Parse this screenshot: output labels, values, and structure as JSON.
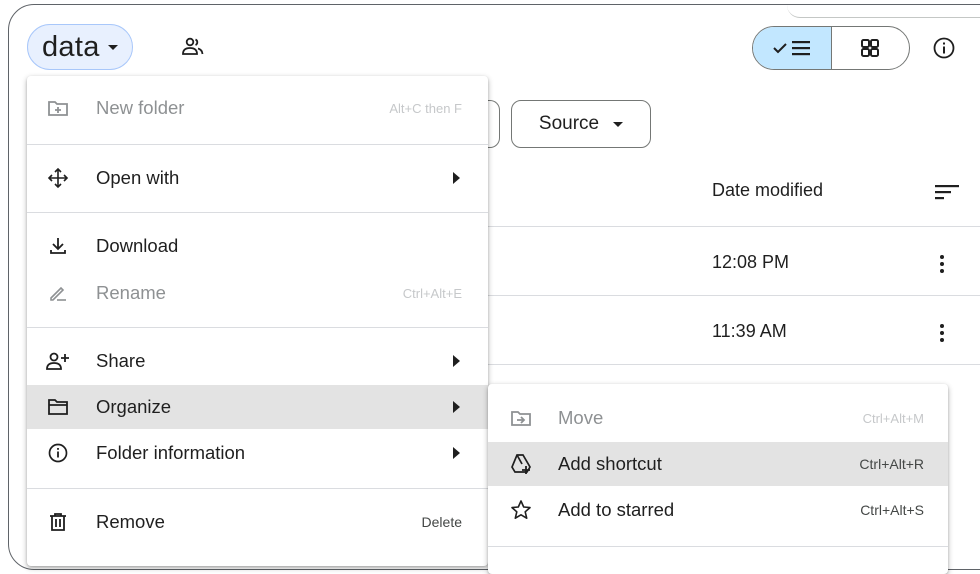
{
  "header": {
    "folder_name": "data",
    "view_list_icon": "check-list-icon",
    "view_grid_icon": "grid-icon"
  },
  "filters": {
    "source_label": "Source"
  },
  "table": {
    "column_date": "Date modified",
    "rows": [
      {
        "date": "12:08 PM"
      },
      {
        "date": "11:39 AM"
      }
    ]
  },
  "context_menu": {
    "items": [
      {
        "label": "New folder",
        "shortcut": "Alt+C then F",
        "icon": "new-folder-icon",
        "disabled": true
      },
      {
        "label": "Open with",
        "icon": "open-with-icon",
        "submenu": true
      },
      {
        "label": "Download",
        "icon": "download-icon"
      },
      {
        "label": "Rename",
        "shortcut": "Ctrl+Alt+E",
        "icon": "rename-icon",
        "disabled": true
      },
      {
        "label": "Share",
        "icon": "share-icon",
        "submenu": true
      },
      {
        "label": "Organize",
        "icon": "organize-folder-icon",
        "submenu": true,
        "highlighted": true
      },
      {
        "label": "Folder information",
        "icon": "info-icon",
        "submenu": true
      },
      {
        "label": "Remove",
        "shortcut": "Delete",
        "icon": "trash-icon"
      }
    ]
  },
  "organize_submenu": {
    "items": [
      {
        "label": "Move",
        "shortcut": "Ctrl+Alt+M",
        "icon": "move-icon",
        "disabled": true
      },
      {
        "label": "Add shortcut",
        "shortcut": "Ctrl+Alt+R",
        "icon": "add-shortcut-icon",
        "highlighted": true
      },
      {
        "label": "Add to starred",
        "shortcut": "Ctrl+Alt+S",
        "icon": "star-icon"
      }
    ]
  },
  "colors": {
    "chip_bg": "#e8f0fe",
    "toggle_active": "#c2e7ff",
    "highlight": "#e3e3e3"
  }
}
